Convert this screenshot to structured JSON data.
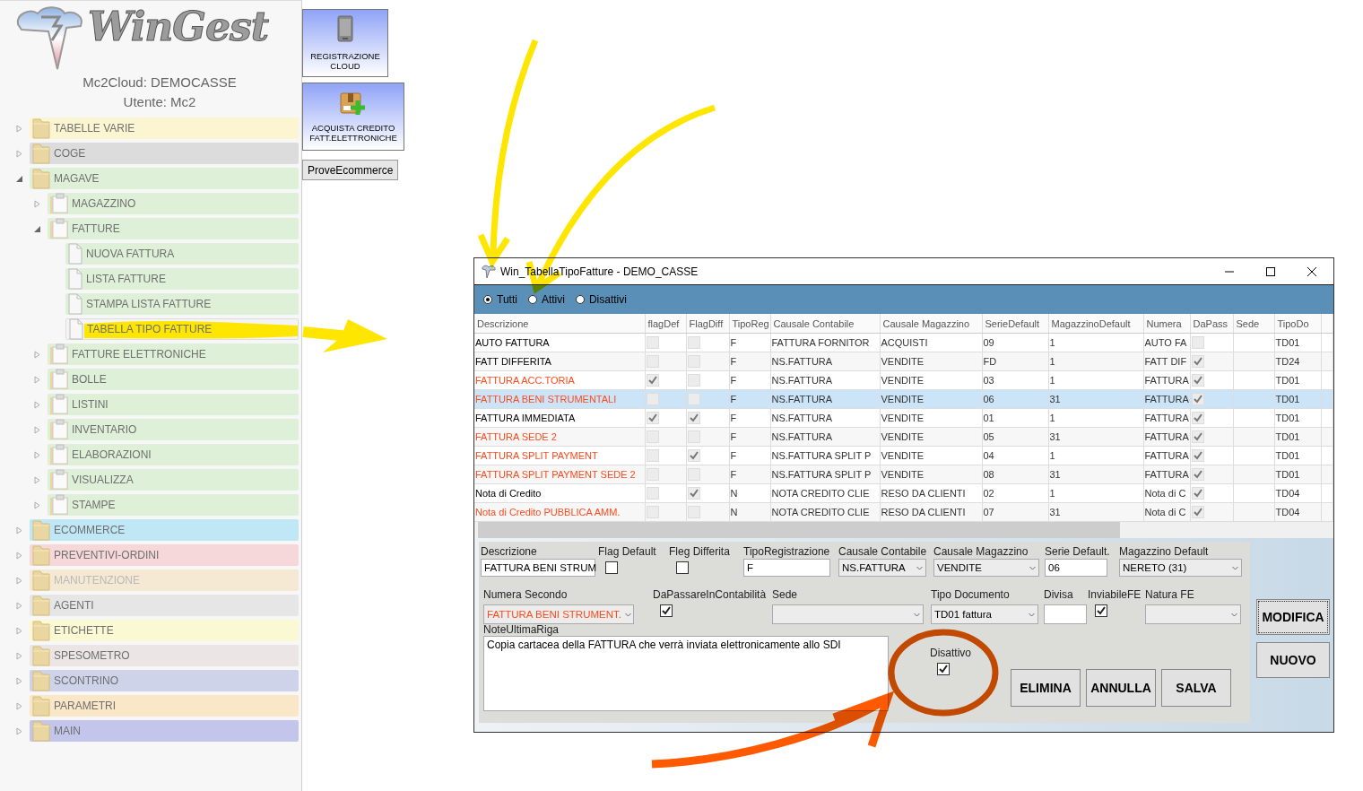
{
  "sidebar": {
    "logo": "WinGest",
    "account": "Mc2Cloud: DEMOCASSE",
    "user": "Utente: Mc2",
    "tree": [
      {
        "label": "TABELLE VARIE",
        "kind": "folder",
        "color": "#fcf5d2",
        "expanded": false,
        "disabled": false,
        "selected": false
      },
      {
        "label": "COGE",
        "kind": "folder",
        "color": "#dcdcdc",
        "expanded": false,
        "disabled": false,
        "selected": false
      },
      {
        "label": "MAGAVE",
        "kind": "folder",
        "color": "#dff0d8",
        "expanded": true,
        "disabled": false,
        "selected": false,
        "children": [
          {
            "label": "MAGAZZINO",
            "kind": "clipboard",
            "expanded": false,
            "selected": false
          },
          {
            "label": "FATTURE",
            "kind": "clipboard",
            "expanded": true,
            "selected": false,
            "children": [
              {
                "label": "NUOVA FATTURA",
                "kind": "document",
                "selected": false
              },
              {
                "label": "LISTA FATTURE",
                "kind": "document",
                "selected": false
              },
              {
                "label": "STAMPA LISTA FATTURE",
                "kind": "document",
                "selected": false
              },
              {
                "label": "TABELLA TIPO FATTURE",
                "kind": "document",
                "selected": true
              }
            ]
          },
          {
            "label": "FATTURE ELETTRONICHE",
            "kind": "clipboard",
            "expanded": false,
            "selected": false
          },
          {
            "label": "BOLLE",
            "kind": "clipboard",
            "expanded": false,
            "selected": false
          },
          {
            "label": "LISTINI",
            "kind": "clipboard",
            "expanded": false,
            "selected": false
          },
          {
            "label": "INVENTARIO",
            "kind": "clipboard",
            "expanded": false,
            "selected": false
          },
          {
            "label": "ELABORAZIONI",
            "kind": "clipboard",
            "expanded": false,
            "selected": false
          },
          {
            "label": "VISUALIZZA",
            "kind": "clipboard",
            "expanded": false,
            "selected": false
          },
          {
            "label": "STAMPE",
            "kind": "clipboard",
            "expanded": false,
            "selected": false
          }
        ]
      },
      {
        "label": "ECOMMERCE",
        "kind": "folder",
        "color": "#bfe7f6",
        "expanded": false,
        "disabled": false,
        "selected": false
      },
      {
        "label": "PREVENTIVI-ORDINI",
        "kind": "folder",
        "color": "#f6d8da",
        "expanded": false,
        "disabled": false,
        "selected": false
      },
      {
        "label": "MANUTENZIONE",
        "kind": "folder",
        "color": "#f6e9d4",
        "expanded": false,
        "disabled": true,
        "selected": false
      },
      {
        "label": "AGENTI",
        "kind": "folder",
        "color": "#e6e6e6",
        "expanded": false,
        "disabled": false,
        "selected": false
      },
      {
        "label": "ETICHETTE",
        "kind": "folder",
        "color": "#fbf9d4",
        "expanded": false,
        "disabled": false,
        "selected": false
      },
      {
        "label": "SPESOMETRO",
        "kind": "folder",
        "color": "#ebe5e5",
        "expanded": false,
        "disabled": false,
        "selected": false
      },
      {
        "label": "SCONTRINO",
        "kind": "folder",
        "color": "#cfd3ea",
        "expanded": false,
        "disabled": false,
        "selected": false
      },
      {
        "label": "PARAMETRI",
        "kind": "folder",
        "color": "#fae7c8",
        "expanded": false,
        "disabled": false,
        "selected": false
      },
      {
        "label": "MAIN",
        "kind": "folder",
        "color": "#c3c5eb",
        "expanded": false,
        "disabled": false,
        "selected": false
      }
    ]
  },
  "tiles": [
    {
      "label": "REGISTRAZIONE CLOUD",
      "kind": "cloud"
    },
    {
      "label": "ACQUISTA CREDITO FATT.ELETTRONICHE",
      "kind": "credit"
    },
    {
      "label": "ProveEcommerce",
      "kind": "plain"
    }
  ],
  "window": {
    "title": "Win_TabellaTipoFatture - DEMO_CASSE",
    "filter": [
      {
        "label": "Tutti",
        "selected": true
      },
      {
        "label": "Attivi",
        "selected": false
      },
      {
        "label": "Disattivi",
        "selected": false
      }
    ],
    "table": {
      "columns": [
        "Descrizione",
        "flagDef",
        "FlagDiff",
        "TipoReg",
        "Causale Contabile",
        "Causale Magazzino",
        "SerieDefault",
        "MagazzinoDefault",
        "Numera",
        "DaPass",
        "Sede",
        "TipoDo"
      ],
      "rows": [
        {
          "descrizione": "AUTO FATTURA",
          "color": "#000000",
          "selected": false,
          "flag_default": false,
          "flag_differita": false,
          "tipo_reg": "F",
          "causale_contabile": "FATTURA FORNITOR",
          "causale_magazzino": "ACQUISTI",
          "serie": "09",
          "magazzino": "1",
          "numera": "AUTO FA",
          "da_passare": false,
          "tipo_doc": "TD01"
        },
        {
          "descrizione": "FATT DIFFERITA",
          "color": "#000000",
          "selected": false,
          "flag_default": false,
          "flag_differita": false,
          "tipo_reg": "F",
          "causale_contabile": "NS.FATTURA",
          "causale_magazzino": "VENDITE",
          "serie": "FD",
          "magazzino": "1",
          "numera": "FATT DIF",
          "da_passare": true,
          "tipo_doc": "TD24"
        },
        {
          "descrizione": "FATTURA ACC.TORIA",
          "color": "#ff4a1c",
          "selected": false,
          "flag_default": true,
          "flag_differita": false,
          "tipo_reg": "F",
          "causale_contabile": "NS.FATTURA",
          "causale_magazzino": "VENDITE",
          "serie": "03",
          "magazzino": "1",
          "numera": "FATTURA",
          "da_passare": true,
          "tipo_doc": "TD01"
        },
        {
          "descrizione": "FATTURA BENI STRUMENTALI",
          "color": "#ff4a1c",
          "selected": true,
          "flag_default": false,
          "flag_differita": false,
          "tipo_reg": "F",
          "causale_contabile": "NS.FATTURA",
          "causale_magazzino": "VENDITE",
          "serie": "06",
          "magazzino": "31",
          "numera": "FATTURA",
          "da_passare": true,
          "tipo_doc": "TD01"
        },
        {
          "descrizione": "FATTURA IMMEDIATA",
          "color": "#000000",
          "selected": false,
          "flag_default": true,
          "flag_differita": true,
          "tipo_reg": "F",
          "causale_contabile": "NS.FATTURA",
          "causale_magazzino": "VENDITE",
          "serie": "01",
          "magazzino": "1",
          "numera": "FATTURA",
          "da_passare": true,
          "tipo_doc": "TD01"
        },
        {
          "descrizione": "FATTURA SEDE 2",
          "color": "#ff4a1c",
          "selected": false,
          "flag_default": false,
          "flag_differita": false,
          "tipo_reg": "F",
          "causale_contabile": "NS.FATTURA",
          "causale_magazzino": "VENDITE",
          "serie": "05",
          "magazzino": "31",
          "numera": "FATTURA",
          "da_passare": true,
          "tipo_doc": "TD01"
        },
        {
          "descrizione": "FATTURA SPLIT PAYMENT",
          "color": "#ff4a1c",
          "selected": false,
          "flag_default": false,
          "flag_differita": true,
          "tipo_reg": "F",
          "causale_contabile": "NS.FATTURA SPLIT P",
          "causale_magazzino": "VENDITE",
          "serie": "04",
          "magazzino": "1",
          "numera": "FATTURA",
          "da_passare": true,
          "tipo_doc": "TD01"
        },
        {
          "descrizione": "FATTURA SPLIT PAYMENT  SEDE 2",
          "color": "#ff4a1c",
          "selected": false,
          "flag_default": false,
          "flag_differita": false,
          "tipo_reg": "F",
          "causale_contabile": "NS.FATTURA SPLIT P",
          "causale_magazzino": "VENDITE",
          "serie": "08",
          "magazzino": "31",
          "numera": "FATTURA",
          "da_passare": true,
          "tipo_doc": "TD01"
        },
        {
          "descrizione": "Nota di Credito",
          "color": "#000000",
          "selected": false,
          "flag_default": false,
          "flag_differita": true,
          "tipo_reg": "N",
          "causale_contabile": "NOTA CREDITO CLIE",
          "causale_magazzino": "RESO DA CLIENTI",
          "serie": "02",
          "magazzino": "1",
          "numera": "Nota di C",
          "da_passare": true,
          "tipo_doc": "TD04"
        },
        {
          "descrizione": "Nota di Credito  PUBBLICA AMM.",
          "color": "#ff4a1c",
          "selected": false,
          "flag_default": false,
          "flag_differita": false,
          "tipo_reg": "N",
          "causale_contabile": "NOTA CREDITO CLIE",
          "causale_magazzino": "RESO DA CLIENTI",
          "serie": "07",
          "magazzino": "31",
          "numera": "Nota di C",
          "da_passare": true,
          "tipo_doc": "TD04"
        }
      ]
    },
    "form": {
      "row_1": [
        {
          "kind": "text",
          "label": "Descrizione",
          "value": "FATTURA BENI STRUM"
        },
        {
          "kind": "check",
          "label": "Flag Default",
          "checked": false
        },
        {
          "kind": "check",
          "label": "Fleg Differita",
          "checked": false
        },
        {
          "kind": "text",
          "label": "TipoRegistrazione",
          "value": "F"
        },
        {
          "kind": "select",
          "label": "Causale Contabile",
          "value": "NS.FATTURA"
        },
        {
          "kind": "select",
          "label": "Causale Magazzino",
          "value": "VENDITE"
        },
        {
          "kind": "text",
          "label": "Serie Default.",
          "value": "06"
        },
        {
          "kind": "select",
          "label": "Magazzino Default",
          "value": "NERETO (31)"
        }
      ],
      "row_2": [
        {
          "kind": "select",
          "label": "Numera Secondo",
          "value": "FATTURA BENI STRUMENT.",
          "color": "#ff4a1c"
        },
        {
          "kind": "check",
          "label": "DaPassareInContabilità",
          "checked": true
        },
        {
          "kind": "select",
          "label": "Sede"
        },
        {
          "kind": "select",
          "label": "Tipo Documento",
          "value": "TD01 fattura"
        },
        {
          "kind": "text",
          "label": "Divisa"
        },
        {
          "kind": "check",
          "label": "InviabileFE",
          "checked": true
        },
        {
          "kind": "select",
          "label": "Natura FE"
        }
      ],
      "notes": {
        "label": "NoteUltimaRiga",
        "value": "Copia cartacea della FATTURA che verrà inviata elettronicamente allo SDI"
      },
      "disattivo": {
        "label": "Disattivo",
        "checked": true
      },
      "actions": [
        "ELIMINA",
        "ANNULLA",
        "SALVA"
      ],
      "side_buttons": [
        {
          "label": "MODIFICA",
          "focused": true
        },
        {
          "label": "NUOVO",
          "focused": false
        }
      ]
    }
  }
}
